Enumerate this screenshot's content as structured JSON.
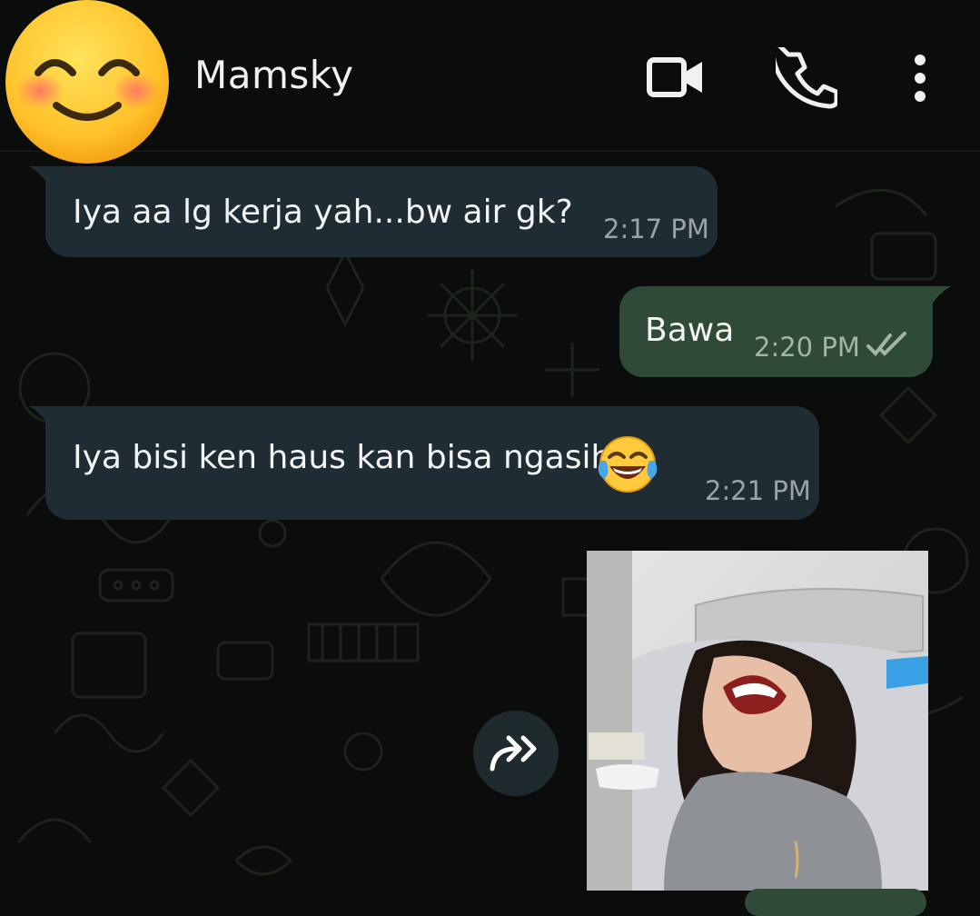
{
  "header": {
    "contact_name": "Mamsky",
    "avatar_icon": "smiling-face-emoji",
    "video_call_icon": "video-camera-icon",
    "voice_call_icon": "phone-icon",
    "menu_icon": "more-vertical-icon"
  },
  "messages": [
    {
      "direction": "incoming",
      "text": "Iya aa lg kerja yah...bw air gk?",
      "time": "2:17 PM"
    },
    {
      "direction": "outgoing",
      "text": "Bawa",
      "time": "2:20 PM",
      "status_icon": "double-check-icon"
    },
    {
      "direction": "incoming",
      "text": "Iya bisi ken haus kan bisa ngasih..",
      "emoji": "face-with-tears-of-joy",
      "time": "2:21 PM"
    },
    {
      "direction": "incoming",
      "type": "image",
      "image_icon": "photo-laughing-child"
    }
  ],
  "forward_icon": "forward-arrows-icon",
  "colors": {
    "background": "#0b0c0c",
    "incoming_bubble": "#202c33",
    "outgoing_bubble": "#2f4a36",
    "timestamp": "#9aa3a7"
  }
}
